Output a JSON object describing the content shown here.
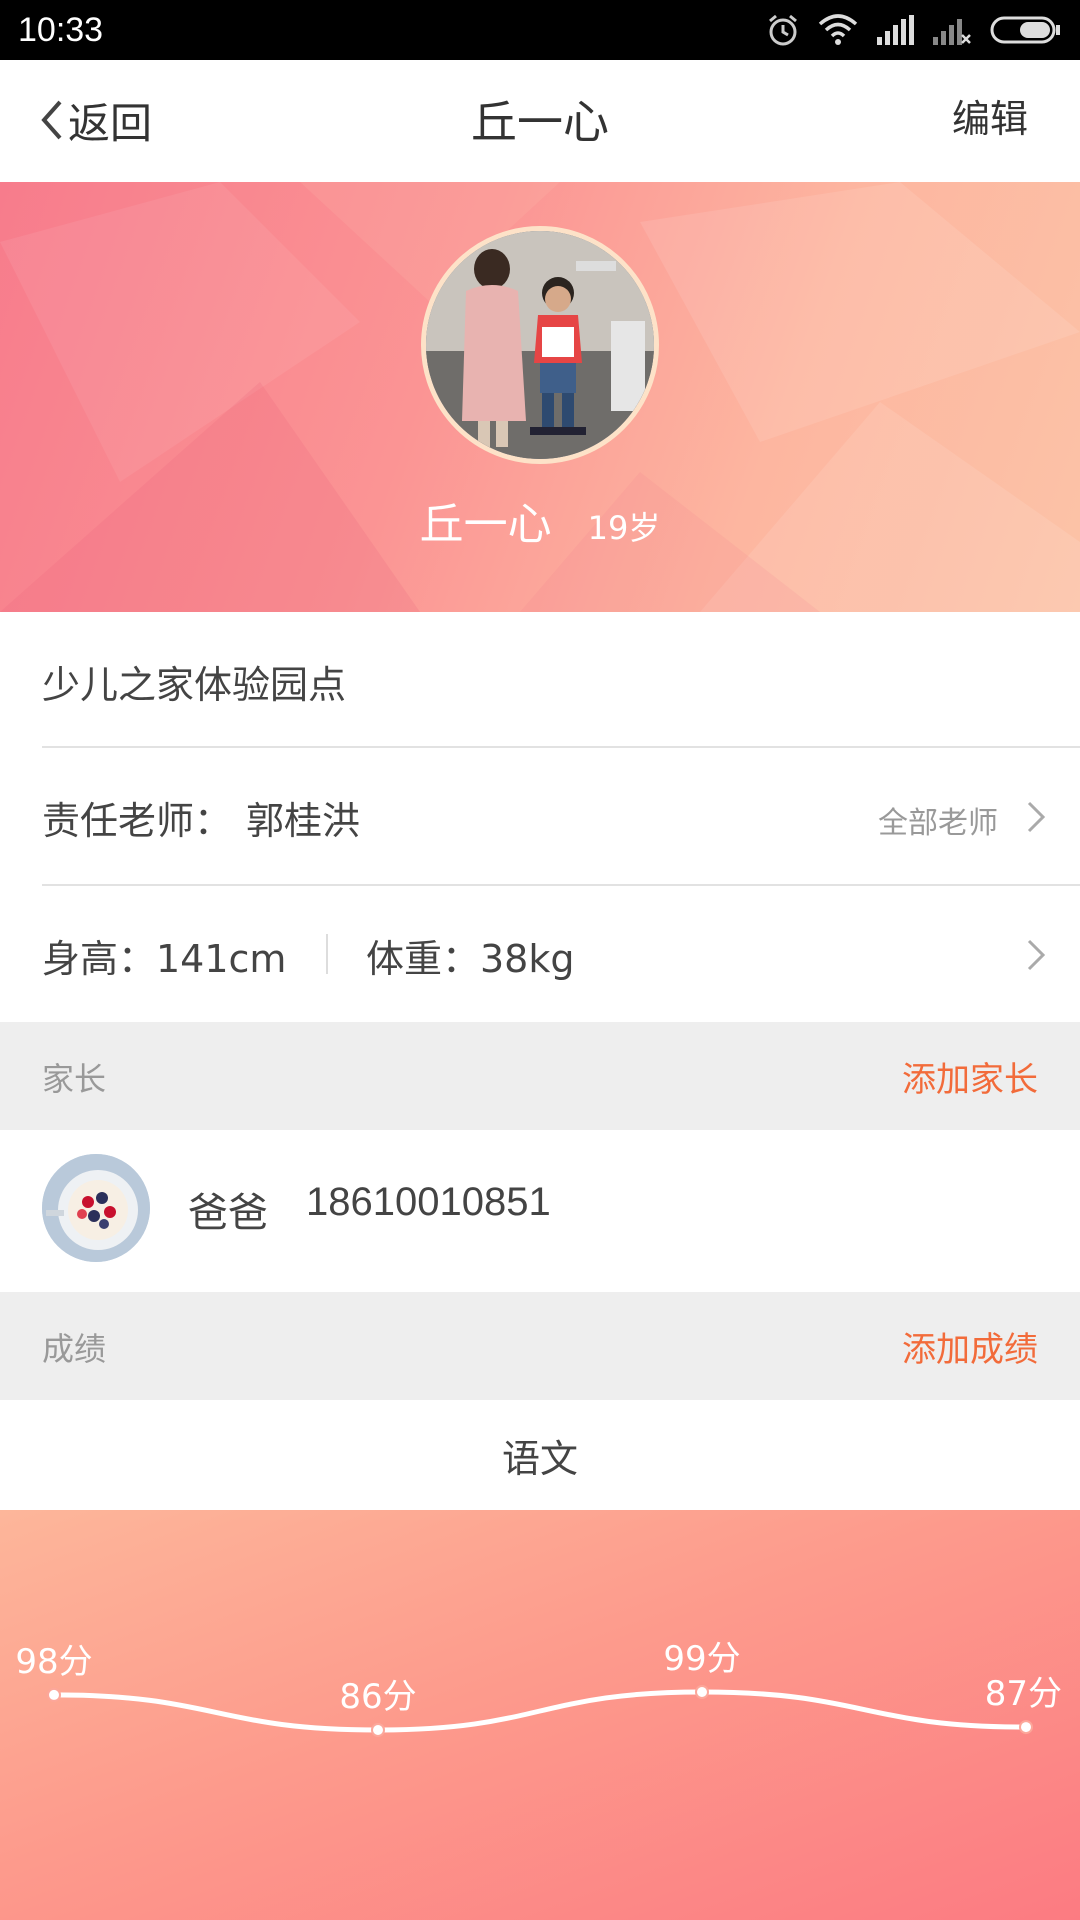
{
  "status_bar": {
    "time": "10:33",
    "icons": [
      "alarm-icon",
      "wifi-icon",
      "signal-icon",
      "signal-no-sim-icon",
      "battery-icon"
    ]
  },
  "nav": {
    "back_label": "返回",
    "title": "丘一心",
    "edit_label": "编辑"
  },
  "profile": {
    "name": "丘一心",
    "age": "19岁"
  },
  "school": {
    "name": "少儿之家体验园点"
  },
  "teacher": {
    "label": "责任老师：",
    "name": "郭桂洪",
    "all_link": "全部老师"
  },
  "body_stats": {
    "height": "身高：141cm",
    "weight": "体重：38kg"
  },
  "parents_section": {
    "title": "家长",
    "action": "添加家长",
    "items": [
      {
        "relation": "爸爸",
        "phone": "18610010851"
      }
    ]
  },
  "scores_section": {
    "title": "成绩",
    "action": "添加成绩",
    "subject": "语文"
  },
  "colors": {
    "accent_orange": "#f26b3a",
    "hero_pink": "#f77c8c",
    "hero_peach": "#fcc3a7"
  },
  "chart_data": {
    "type": "line",
    "title": "",
    "xlabel": "",
    "ylabel": "",
    "grid": false,
    "series": [
      {
        "values": [
          98,
          86,
          99,
          87
        ],
        "labels": [
          "98分",
          "86分",
          "99分",
          "87分"
        ]
      }
    ]
  }
}
